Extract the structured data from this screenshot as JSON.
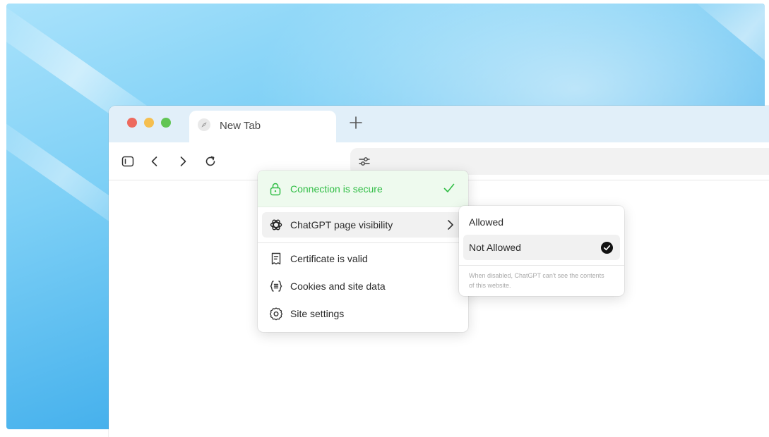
{
  "browser": {
    "tab": {
      "title": "New Tab",
      "icon": "compass-icon"
    },
    "toolbar": {
      "buttons": [
        "sidebar-icon",
        "back-icon",
        "forward-icon",
        "reload-icon"
      ],
      "address_icon": "site-controls-icon"
    }
  },
  "site_menu": {
    "secure_label": "Connection is secure",
    "items": [
      {
        "label": "ChatGPT page visibility",
        "icon": "openai-icon",
        "has_submenu": true,
        "highlighted": true
      },
      {
        "label": "Certificate is valid",
        "icon": "certificate-icon"
      },
      {
        "label": "Cookies and site data",
        "icon": "cookies-icon"
      },
      {
        "label": "Site settings",
        "icon": "gear-icon"
      }
    ]
  },
  "visibility_submenu": {
    "options": [
      {
        "label": "Allowed",
        "selected": false
      },
      {
        "label": "Not Allowed",
        "selected": true
      }
    ],
    "note": "When disabled, ChatGPT can't see the contents of this website."
  },
  "colors": {
    "secure_green": "#2fbd44",
    "accent_bg": "#e1eff9"
  }
}
